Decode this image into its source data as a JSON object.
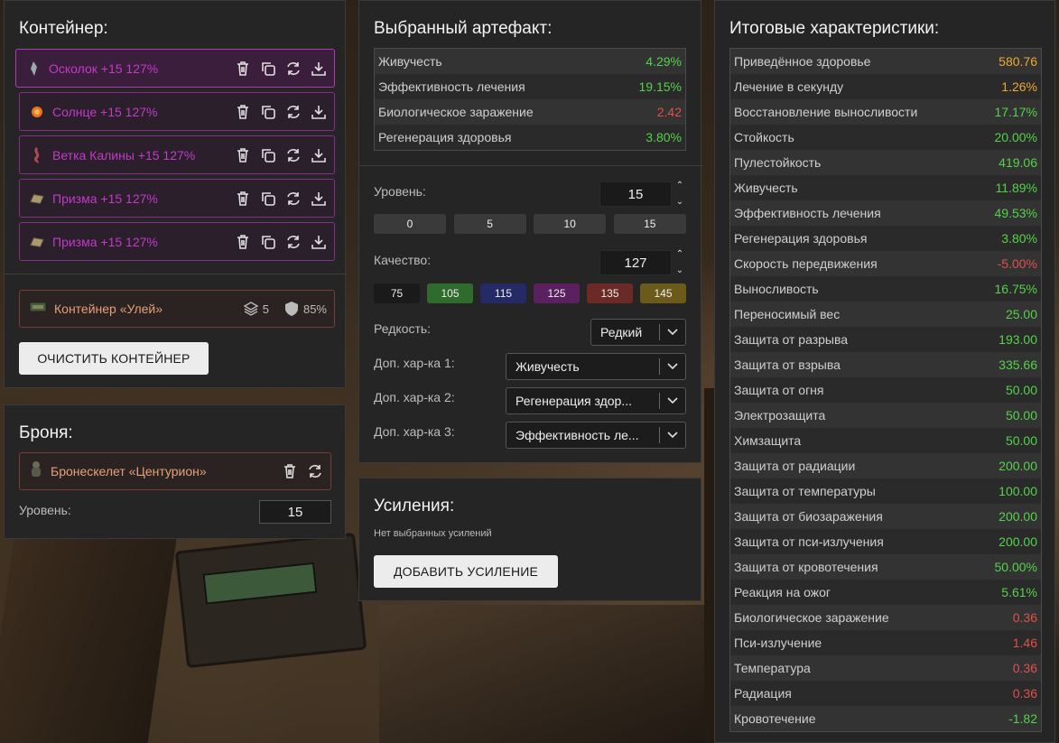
{
  "container": {
    "title": "Контейнер:",
    "artifacts": [
      {
        "name": "Осколок +15 127%",
        "icon": "shard-icon"
      },
      {
        "name": "Солнце +15 127%",
        "icon": "sun-icon"
      },
      {
        "name": "Ветка Калины +15 127%",
        "icon": "branch-icon"
      },
      {
        "name": "Призма +15 127%",
        "icon": "prism-icon"
      },
      {
        "name": "Призма +15 127%",
        "icon": "prism-icon"
      }
    ],
    "box": {
      "name": "Контейнер «Улей»",
      "slots": "5",
      "protection": "85%"
    },
    "clear_label": "ОЧИСТИТЬ КОНТЕЙНЕР"
  },
  "armor": {
    "title": "Броня:",
    "name": "Бронескелет «Центурион»",
    "level_label": "Уровень:",
    "level": "15"
  },
  "artifact": {
    "title": "Выбранный артефакт:",
    "stats": [
      {
        "label": "Живучесть",
        "value": "4.29%",
        "tone": "g"
      },
      {
        "label": "Эффективность лечения",
        "value": "19.15%",
        "tone": "g"
      },
      {
        "label": "Биологическое заражение",
        "value": "2.42",
        "tone": "r"
      },
      {
        "label": "Регенерация здоровья",
        "value": "3.80%",
        "tone": "g"
      }
    ],
    "level_label": "Уровень:",
    "level": "15",
    "level_presets": [
      "0",
      "5",
      "10",
      "15"
    ],
    "quality_label": "Качество:",
    "quality": "127",
    "quality_presets": [
      "75",
      "105",
      "115",
      "125",
      "135",
      "145"
    ],
    "rarity_label": "Редкость:",
    "rarity": "Редкий",
    "extra1_label": "Доп. хар-ка 1:",
    "extra1": "Живучесть",
    "extra2_label": "Доп. хар-ка 2:",
    "extra2": "Регенерация здор...",
    "extra3_label": "Доп. хар-ка 3:",
    "extra3": "Эффективность ле..."
  },
  "boosts": {
    "title": "Усиления:",
    "empty": "Нет выбранных усилений",
    "add_label": "ДОБАВИТЬ УСИЛЕНИЕ"
  },
  "totals": {
    "title": "Итоговые характеристики:",
    "stats": [
      {
        "label": "Приведённое здоровье",
        "value": "580.76",
        "tone": "o"
      },
      {
        "label": "Лечение в секунду",
        "value": "1.26%",
        "tone": "o"
      },
      {
        "label": "Восстановление выносливости",
        "value": "17.17%",
        "tone": "g"
      },
      {
        "label": "Стойкость",
        "value": "20.00%",
        "tone": "g"
      },
      {
        "label": "Пулестойкость",
        "value": "419.06",
        "tone": "g"
      },
      {
        "label": "Живучесть",
        "value": "11.89%",
        "tone": "g"
      },
      {
        "label": "Эффективность лечения",
        "value": "49.53%",
        "tone": "g"
      },
      {
        "label": "Регенерация здоровья",
        "value": "3.80%",
        "tone": "g"
      },
      {
        "label": "Скорость передвижения",
        "value": "-5.00%",
        "tone": "r"
      },
      {
        "label": "Выносливость",
        "value": "16.75%",
        "tone": "g"
      },
      {
        "label": "Переносимый вес",
        "value": "25.00",
        "tone": "g"
      },
      {
        "label": "Защита от разрыва",
        "value": "193.00",
        "tone": "g"
      },
      {
        "label": "Защита от взрыва",
        "value": "335.66",
        "tone": "g"
      },
      {
        "label": "Защита от огня",
        "value": "50.00",
        "tone": "g"
      },
      {
        "label": "Электрозащита",
        "value": "50.00",
        "tone": "g"
      },
      {
        "label": "Химзащита",
        "value": "50.00",
        "tone": "g"
      },
      {
        "label": "Защита от радиации",
        "value": "200.00",
        "tone": "g"
      },
      {
        "label": "Защита от температуры",
        "value": "100.00",
        "tone": "g"
      },
      {
        "label": "Защита от биозаражения",
        "value": "200.00",
        "tone": "g"
      },
      {
        "label": "Защита от пси-излучения",
        "value": "200.00",
        "tone": "g"
      },
      {
        "label": "Защита от кровотечения",
        "value": "50.00%",
        "tone": "g"
      },
      {
        "label": "Реакция на ожог",
        "value": "5.61%",
        "tone": "g"
      },
      {
        "label": "Биологическое заражение",
        "value": "0.36",
        "tone": "r"
      },
      {
        "label": "Пси-излучение",
        "value": "1.46",
        "tone": "r"
      },
      {
        "label": "Температура",
        "value": "0.36",
        "tone": "r"
      },
      {
        "label": "Радиация",
        "value": "0.36",
        "tone": "r"
      },
      {
        "label": "Кровотечение",
        "value": "-1.82",
        "tone": "g"
      }
    ]
  },
  "colors": {
    "artifact_border": "#8a2b8f",
    "artifact_text": "#c23ac8",
    "positive": "#54d24a",
    "negative": "#e0504a",
    "highlight": "#f0a830",
    "quality_75": "#1a1a1a",
    "quality_105": "#2f6b2c",
    "quality_115": "#232a66",
    "quality_125": "#5a2160",
    "quality_135": "#6b2a26",
    "quality_145": "#6b5a1a"
  }
}
